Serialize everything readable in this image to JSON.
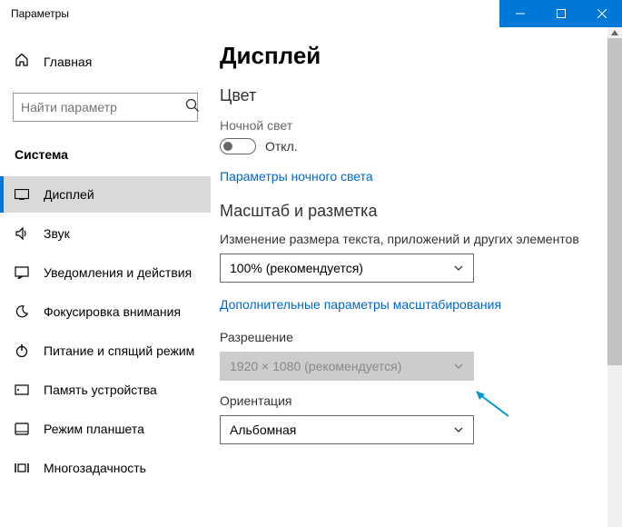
{
  "window": {
    "title": "Параметры"
  },
  "sidebar": {
    "home": "Главная",
    "search_placeholder": "Найти параметр",
    "category": "Система",
    "items": [
      {
        "label": "Дисплей"
      },
      {
        "label": "Звук"
      },
      {
        "label": "Уведомления и действия"
      },
      {
        "label": "Фокусировка внимания"
      },
      {
        "label": "Питание и спящий режим"
      },
      {
        "label": "Память устройства"
      },
      {
        "label": "Режим планшета"
      },
      {
        "label": "Многозадачность"
      }
    ]
  },
  "main": {
    "title": "Дисплей",
    "color_h": "Цвет",
    "nightlight_label": "Ночной свет",
    "toggle_state": "Откл.",
    "nightlight_link": "Параметры ночного света",
    "scale_h": "Масштаб и разметка",
    "scale_field": "Изменение размера текста, приложений и других элементов",
    "scale_value": "100% (рекомендуется)",
    "scale_link": "Дополнительные параметры масштабирования",
    "resolution_label": "Разрешение",
    "resolution_value": "1920 × 1080 (рекомендуется)",
    "orientation_label": "Ориентация",
    "orientation_value": "Альбомная"
  }
}
